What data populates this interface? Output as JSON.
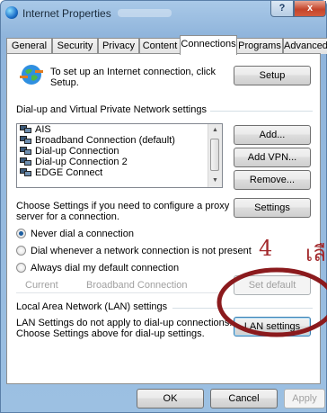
{
  "window": {
    "title": "Internet Properties",
    "help_label": "?",
    "close_label": "x"
  },
  "tabs": [
    {
      "label": "General"
    },
    {
      "label": "Security"
    },
    {
      "label": "Privacy"
    },
    {
      "label": "Content"
    },
    {
      "label": "Connections"
    },
    {
      "label": "Programs"
    },
    {
      "label": "Advanced"
    }
  ],
  "active_tab": "Connections",
  "setup_section": {
    "text_line1": "To set up an Internet connection, click",
    "text_line2": "Setup.",
    "setup_button": "Setup"
  },
  "dialup_section": {
    "title": "Dial-up and Virtual Private Network settings",
    "connections": [
      "AIS",
      "Broadband Connection (default)",
      "Dial-up Connection",
      "Dial-up Connection 2",
      "EDGE Connect"
    ],
    "add_button": "Add...",
    "add_vpn_button": "Add VPN...",
    "remove_button": "Remove...",
    "proxy_text_line1": "Choose Settings if you need to configure a proxy",
    "proxy_text_line2": "server for a connection.",
    "settings_button": "Settings",
    "radio_options": [
      {
        "label": "Never dial a connection",
        "checked": true
      },
      {
        "label": "Dial whenever a network connection is not present",
        "checked": false
      },
      {
        "label": "Always dial my default connection",
        "checked": false
      }
    ],
    "current_label": "Current",
    "current_value": "Broadband Connection",
    "set_default_button": "Set default"
  },
  "lan_section": {
    "title": "Local Area Network (LAN) settings",
    "text_line1": "LAN Settings do not apply to dial-up connections.",
    "text_line2": "Choose Settings above for dial-up settings.",
    "lan_button": "LAN settings"
  },
  "footer": {
    "ok_button": "OK",
    "cancel_button": "Cancel",
    "apply_button": "Apply"
  },
  "annotation": {
    "step_number": "4",
    "thai_text": "เลื",
    "color": "#a3292c"
  }
}
